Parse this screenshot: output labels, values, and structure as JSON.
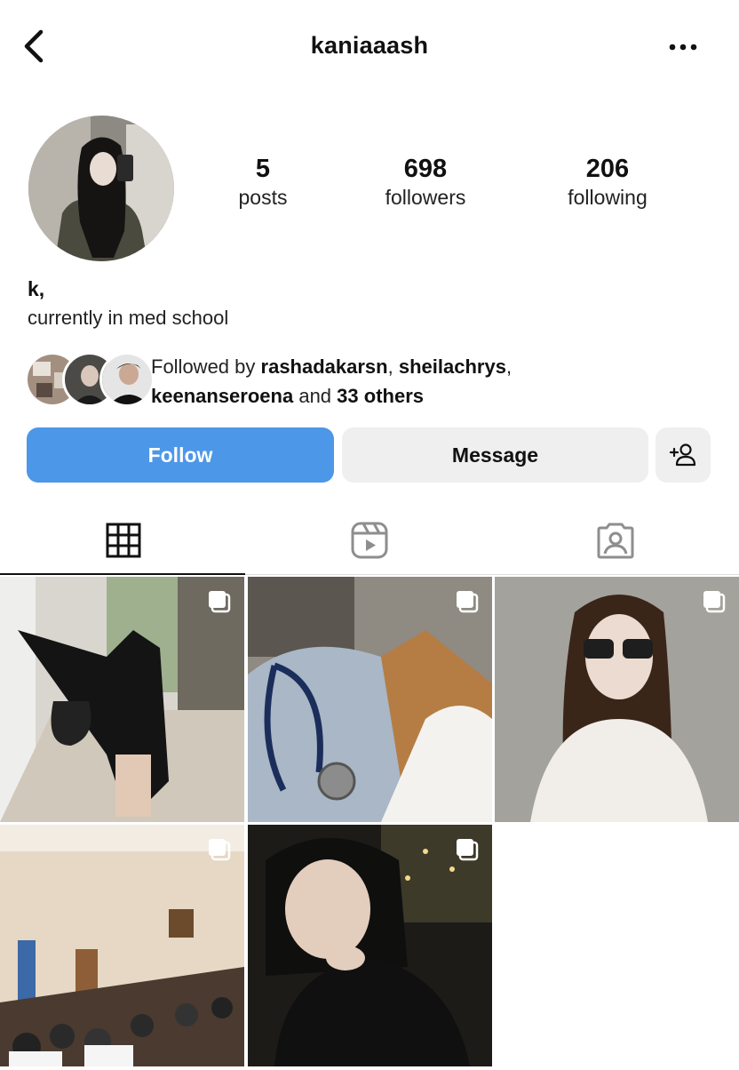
{
  "header": {
    "username": "kaniaaash",
    "back_icon": "chevron-left-icon",
    "more_icon": "more-horizontal-icon"
  },
  "profile": {
    "stats": [
      {
        "value": "5",
        "label": "posts"
      },
      {
        "value": "698",
        "label": "followers"
      },
      {
        "value": "206",
        "label": "following"
      }
    ],
    "display_name": "k,",
    "bio": "currently in med school"
  },
  "followed_by": {
    "prefix": "Followed by",
    "names": [
      "rashadakarsn",
      "sheilachrys",
      "keenanseroena"
    ],
    "and": "and",
    "others": "33 others"
  },
  "actions": {
    "follow_label": "Follow",
    "message_label": "Message",
    "add_icon": "add-person-icon"
  },
  "tabs": [
    {
      "name": "posts-grid",
      "icon": "grid-icon",
      "active": true
    },
    {
      "name": "reels",
      "icon": "reels-icon",
      "active": false
    },
    {
      "name": "tagged",
      "icon": "tagged-person-icon",
      "active": false
    }
  ],
  "posts": [
    {
      "scene": "woman in black walking on sidewalk",
      "multi": true
    },
    {
      "scene": "stethoscope on jeans",
      "multi": true
    },
    {
      "scene": "woman with sunglasses, white cardigan",
      "multi": true
    },
    {
      "scene": "lecture hall full of students",
      "multi": true
    },
    {
      "scene": "woman resting chin on hand at night",
      "multi": true
    }
  ],
  "colors": {
    "follow_button": "#4d97e8",
    "secondary_button": "#efefef"
  }
}
